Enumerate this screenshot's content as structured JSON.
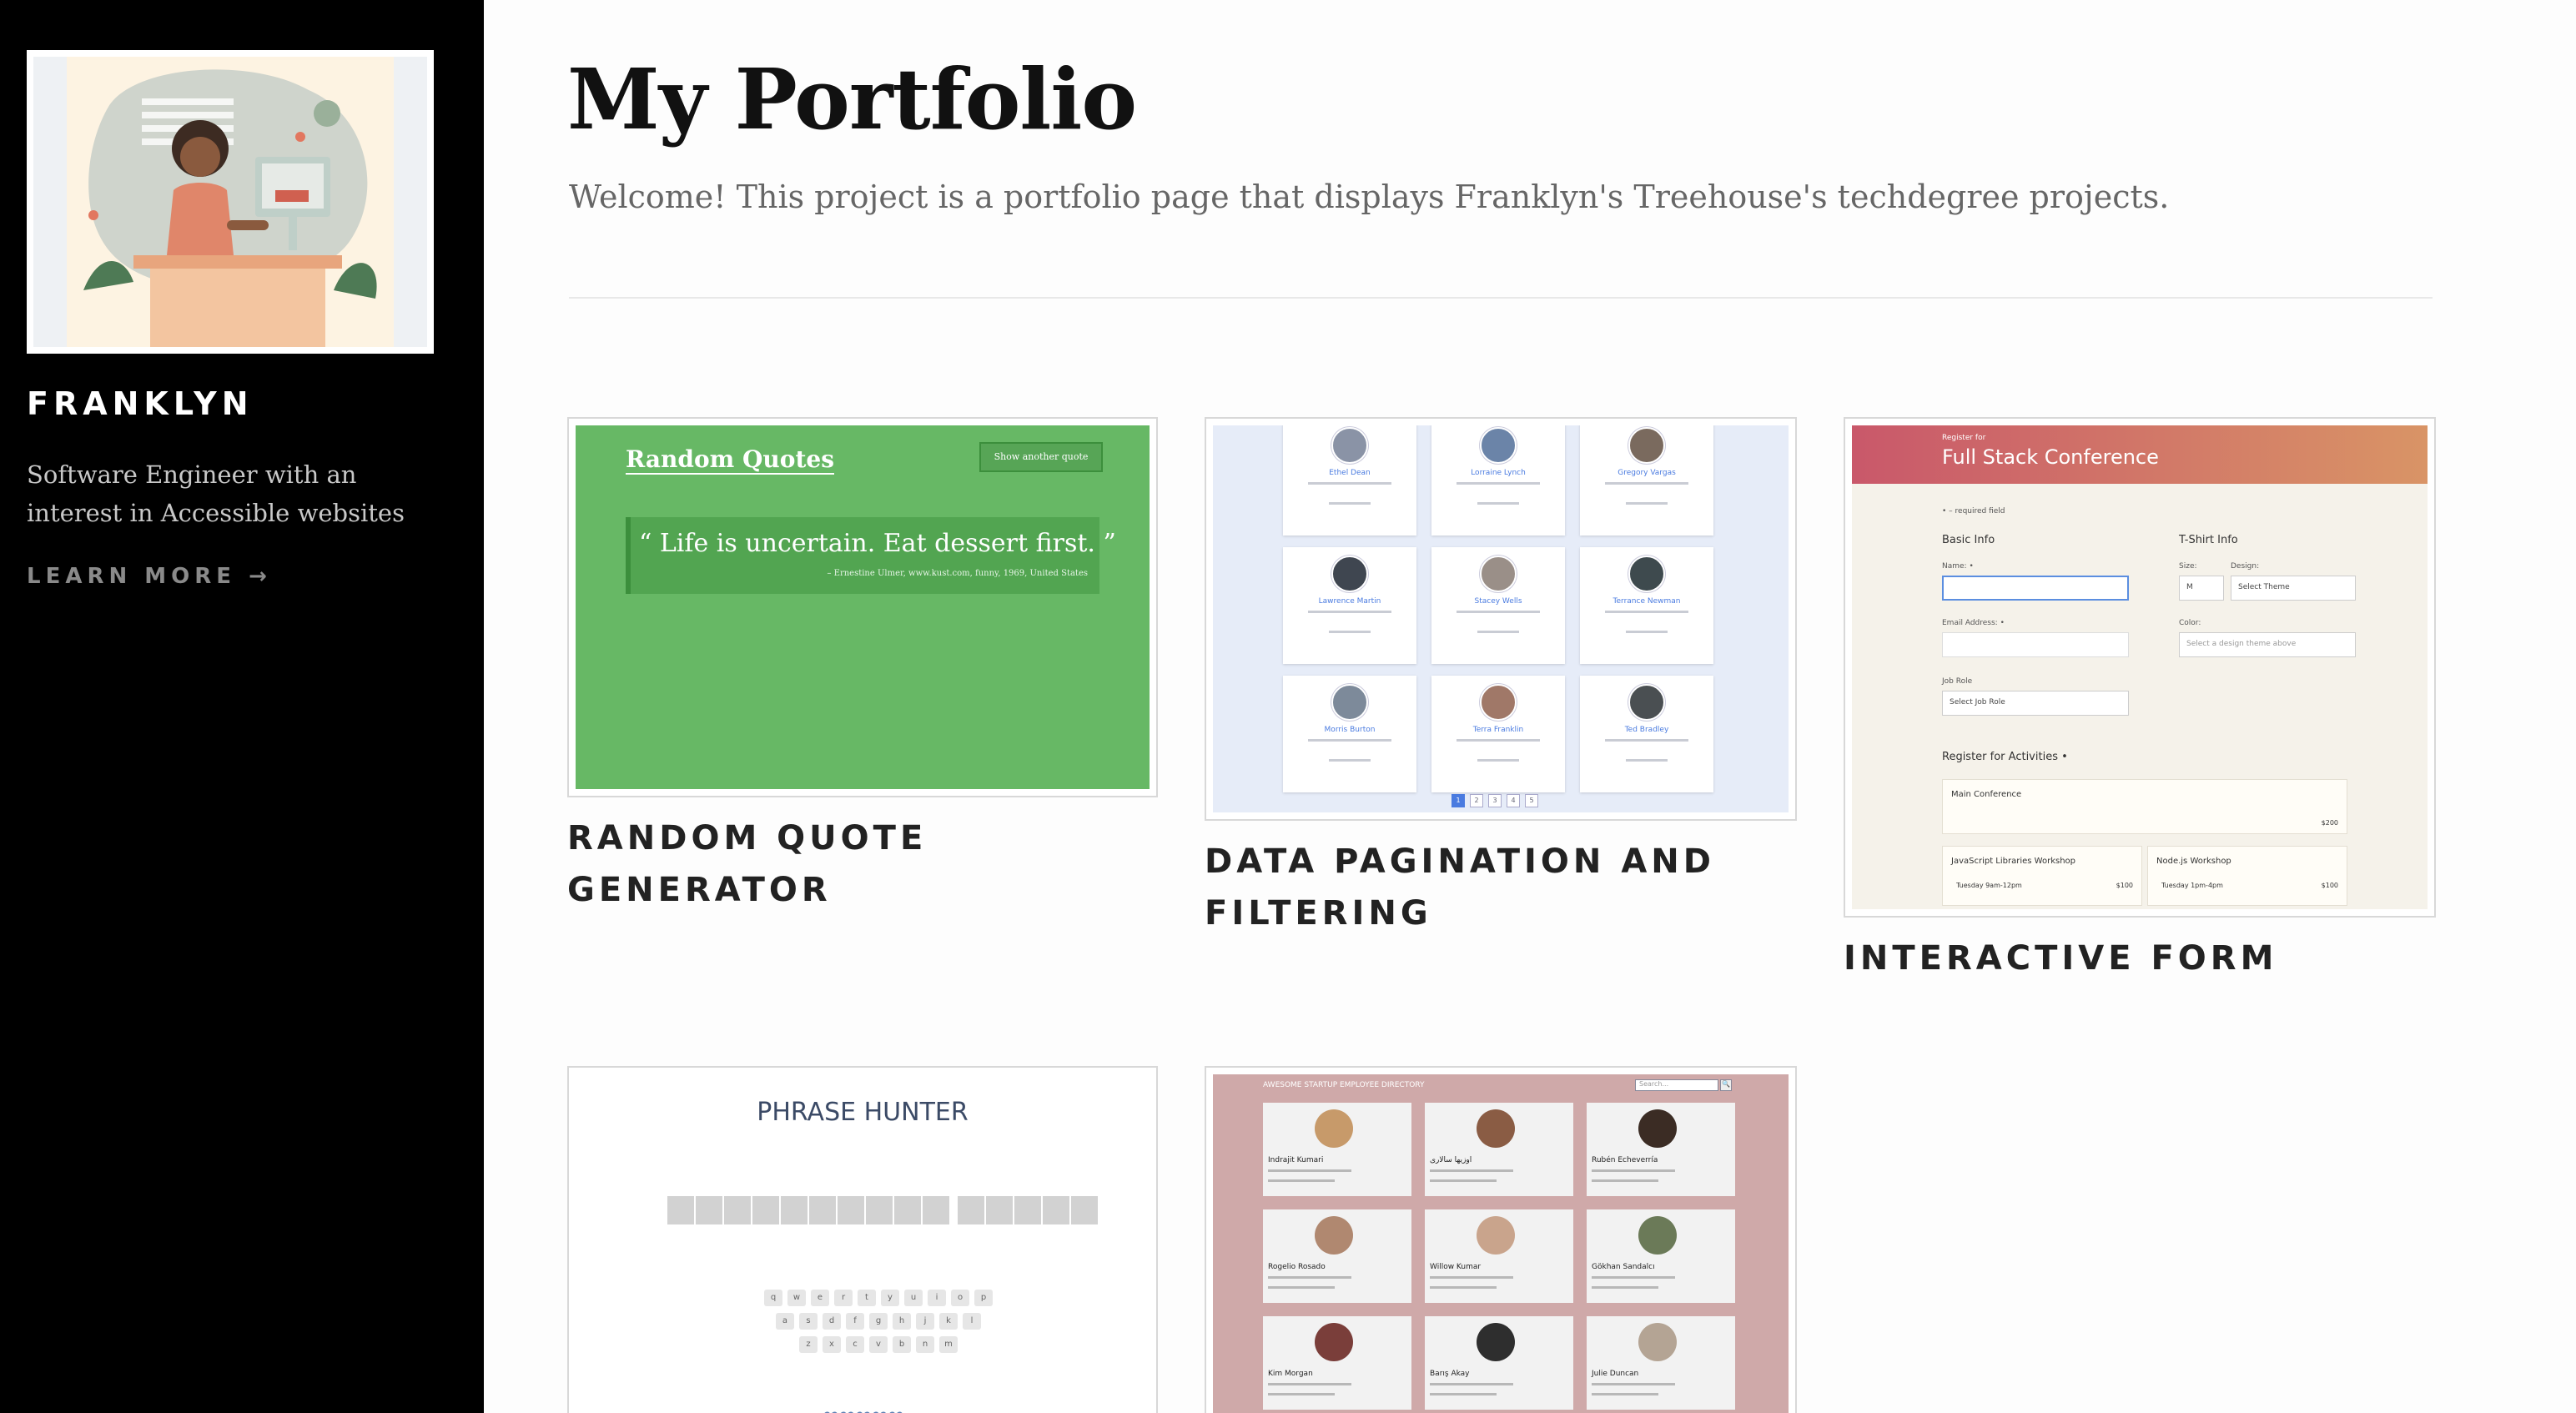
{
  "sidebar": {
    "name": "FRANKLYN",
    "bio": "Software Engineer with an interest in Accessible websites",
    "learn_more": "LEARN MORE →"
  },
  "main": {
    "title": "My Portfolio",
    "subtitle": "Welcome! This project is a portfolio page that displays Franklyn's Treehouse's techdegree projects."
  },
  "projects": [
    {
      "title": "RANDOM QUOTE GENERATOR",
      "thumb": {
        "heading": "Random Quotes",
        "button": "Show another quote",
        "quote": "“ Life is uncertain. Eat dessert first. ”",
        "citation": "– Ernestine Ulmer, www.kust.com, funny, 1969, United States"
      }
    },
    {
      "title": "DATA PAGINATION AND FILTERING",
      "thumb": {
        "people": [
          "Ethel Dean",
          "Lorraine Lynch",
          "Gregory Vargas",
          "Lawrence Martin",
          "Stacey Wells",
          "Terrance Newman",
          "Morris Burton",
          "Terra Franklin",
          "Ted Bradley"
        ],
        "pages": [
          "1",
          "2",
          "3",
          "4",
          "5"
        ]
      }
    },
    {
      "title": "INTERACTIVE FORM",
      "thumb": {
        "register_for": "Register for",
        "conference": "Full Stack Conference",
        "required": "• – required field",
        "basic_info": "Basic Info",
        "tshirt_info": "T-Shirt Info",
        "name_label": "Name: •",
        "email_label": "Email Address: •",
        "job_role_label": "Job Role",
        "job_role_select": "Select Job Role",
        "size_label": "Size:",
        "size_select": "M",
        "design_label": "Design:",
        "design_select": "Select Theme",
        "color_label": "Color:",
        "color_select": "Select a design theme above",
        "activities_label": "Register for Activities •",
        "main_conference": "Main Conference",
        "main_price": "$200",
        "js_workshop": "JavaScript Libraries Workshop",
        "js_time": "Tuesday 9am-12pm",
        "js_price": "$100",
        "node_workshop": "Node.js Workshop",
        "node_time": "Tuesday 1pm-4pm",
        "node_price": "$100"
      }
    },
    {
      "title": "PHRASE HUNTER",
      "thumb": {
        "heading": "PHRASE HUNTER",
        "row1": [
          "q",
          "w",
          "e",
          "r",
          "t",
          "y",
          "u",
          "i",
          "o",
          "p"
        ],
        "row2": [
          "a",
          "s",
          "d",
          "f",
          "g",
          "h",
          "j",
          "k",
          "l"
        ],
        "row3": [
          "z",
          "x",
          "c",
          "v",
          "b",
          "n",
          "m"
        ],
        "hearts": "♥♥♥♥♥"
      }
    },
    {
      "title": "EMPLOYEE DIRECTORY",
      "thumb": {
        "heading": "AWESOME STARTUP EMPLOYEE DIRECTORY",
        "search_placeholder": "Search...",
        "search_button": "🔍",
        "people": [
          "Indrajit Kumari",
          "اوزیها سالاری",
          "Rubén Echeverría",
          "Rogelio Rosado",
          "Willow Kumar",
          "Gökhan Sandalcı",
          "Kim Morgan",
          "Barış Akay",
          "Julie Duncan"
        ]
      }
    }
  ],
  "colors": {
    "sidebar_bg": "#000000",
    "quote_green": "#67b865",
    "pagination_blue": "#4a7be0",
    "form_gradient_start": "#c9586a",
    "form_gradient_end": "#d99466",
    "directory_bg": "#cfa9a9"
  }
}
